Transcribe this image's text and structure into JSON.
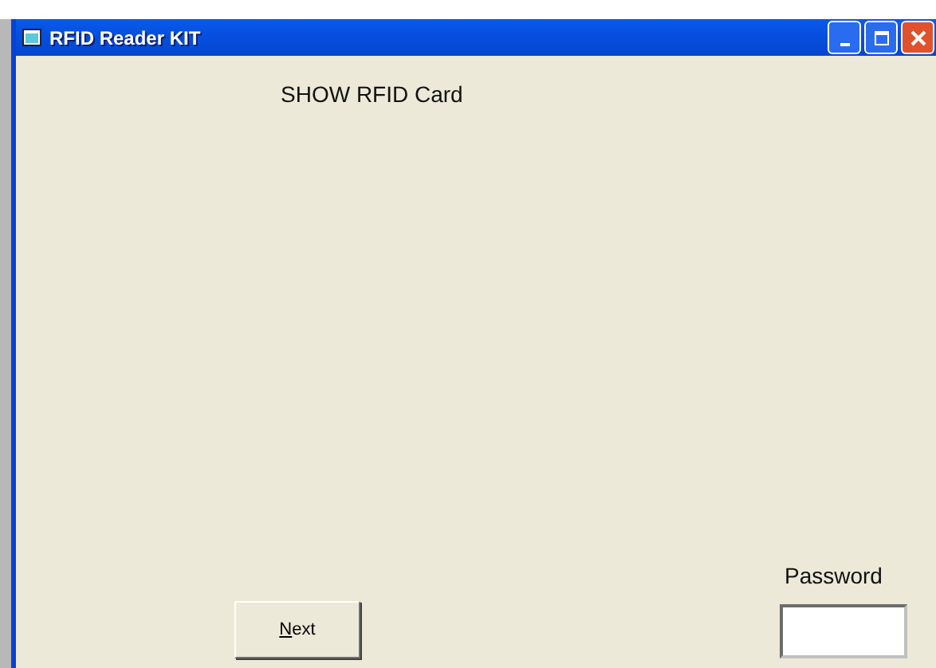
{
  "window": {
    "title": "RFID Reader KIT"
  },
  "prompt": "SHOW RFID Card",
  "password": {
    "label": "Password"
  },
  "next_button": {
    "label": "Next",
    "mnemonic_underlined": true
  }
}
